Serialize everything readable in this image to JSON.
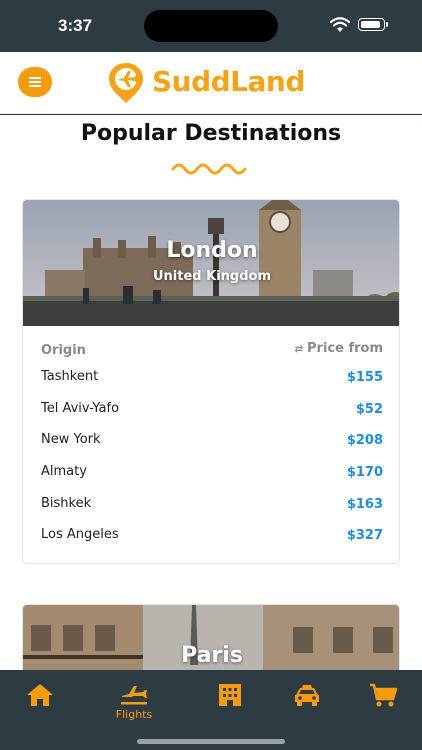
{
  "status_bar": {
    "time": "3:37"
  },
  "header": {
    "brand": "SuddLand",
    "menu_icon": "hamburger-icon"
  },
  "page": {
    "title": "Popular Destinations"
  },
  "destinations": [
    {
      "city": "London",
      "country": "United Kingdom",
      "origin_header": "Origin",
      "price_header": "Price from",
      "routes": [
        {
          "origin": "Tashkent",
          "price": "$155"
        },
        {
          "origin": "Tel Aviv-Yafo",
          "price": "$52"
        },
        {
          "origin": "New York",
          "price": "$208"
        },
        {
          "origin": "Almaty",
          "price": "$170"
        },
        {
          "origin": "Bishkek",
          "price": "$163"
        },
        {
          "origin": "Los Angeles",
          "price": "$327"
        }
      ]
    },
    {
      "city": "Paris"
    }
  ],
  "tabbar": {
    "tabs": [
      {
        "icon": "home-icon",
        "label": ""
      },
      {
        "icon": "plane-icon",
        "label": "Flights"
      },
      {
        "icon": "hotel-icon",
        "label": ""
      },
      {
        "icon": "taxi-icon",
        "label": ""
      },
      {
        "icon": "cart-icon",
        "label": ""
      }
    ]
  },
  "colors": {
    "accent": "#f59b10",
    "price": "#1f8ce0",
    "bar": "#2f3b42"
  }
}
